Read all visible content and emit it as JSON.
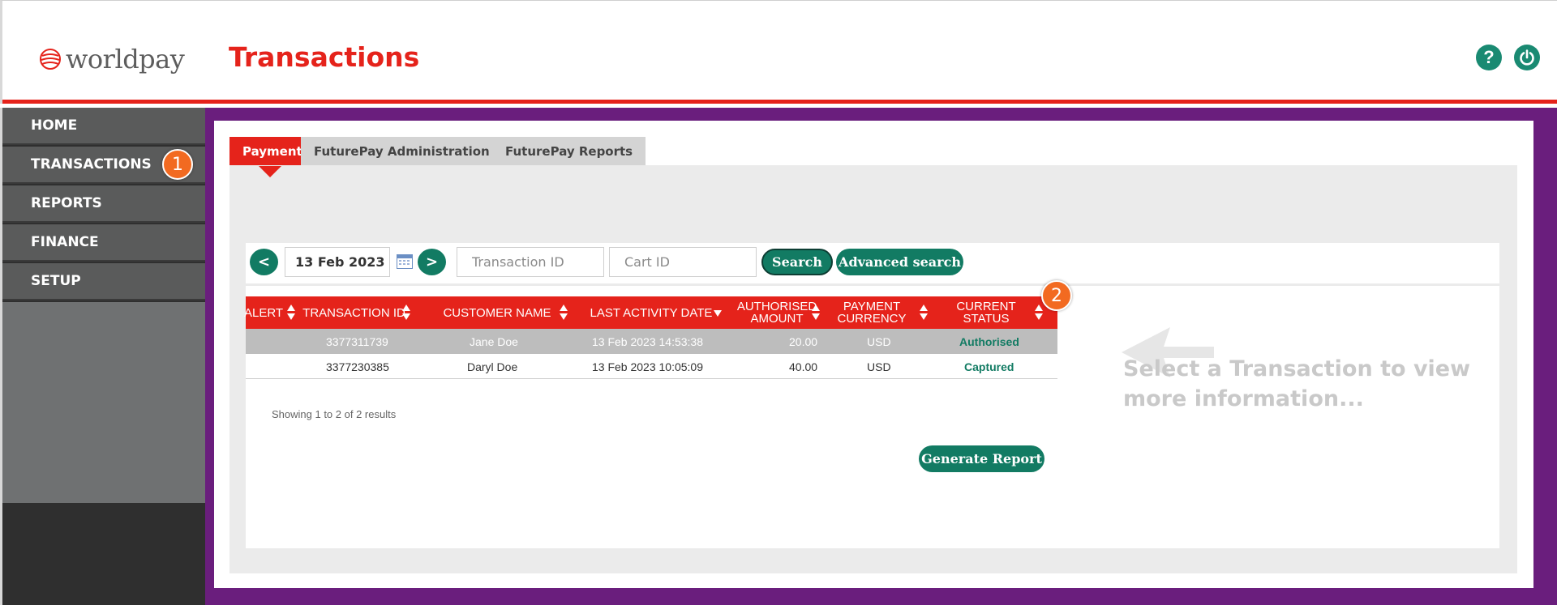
{
  "header": {
    "logo_text": "worldpay",
    "page_title": "Transactions",
    "help_icon": "?",
    "power_icon": "power-icon"
  },
  "sidebar": {
    "items": [
      {
        "label": "HOME"
      },
      {
        "label": "TRANSACTIONS"
      },
      {
        "label": "REPORTS"
      },
      {
        "label": "FINANCE"
      },
      {
        "label": "SETUP"
      }
    ]
  },
  "callouts": {
    "one": "1",
    "two": "2"
  },
  "tabs": [
    {
      "label": "Payments",
      "active": true
    },
    {
      "label": "FuturePay Administration",
      "active": false
    },
    {
      "label": "FuturePay Reports",
      "active": false
    }
  ],
  "search": {
    "prev_label": "<",
    "date": "13 Feb 2023",
    "next_label": ">",
    "transaction_id_placeholder": "Transaction ID",
    "cart_id_placeholder": "Cart ID",
    "search_label": "Search",
    "advanced_label": "Advanced search"
  },
  "table": {
    "columns": [
      "ALERT",
      "TRANSACTION ID",
      "CUSTOMER NAME",
      "LAST ACTIVITY DATE",
      "AUTHORISED AMOUNT",
      "PAYMENT CURRENCY",
      "CURRENT STATUS"
    ],
    "rows": [
      {
        "alert": "",
        "id": "3377311739",
        "name": "Jane Doe",
        "date": "13 Feb 2023 14:53:38",
        "amount": "20.00",
        "currency": "USD",
        "status": "Authorised",
        "selected": true
      },
      {
        "alert": "",
        "id": "3377230385",
        "name": "Daryl Doe",
        "date": "13 Feb 2023 10:05:09",
        "amount": "40.00",
        "currency": "USD",
        "status": "Captured",
        "selected": false
      }
    ],
    "results_text": "Showing 1 to 2 of 2 results"
  },
  "generate_report_label": "Generate Report",
  "hint": "Select a Transaction to view more information...",
  "colors": {
    "brand_red": "#e5231b",
    "teal": "#127b63",
    "purple": "#6a1e7d",
    "callout_orange": "#f26a21"
  }
}
